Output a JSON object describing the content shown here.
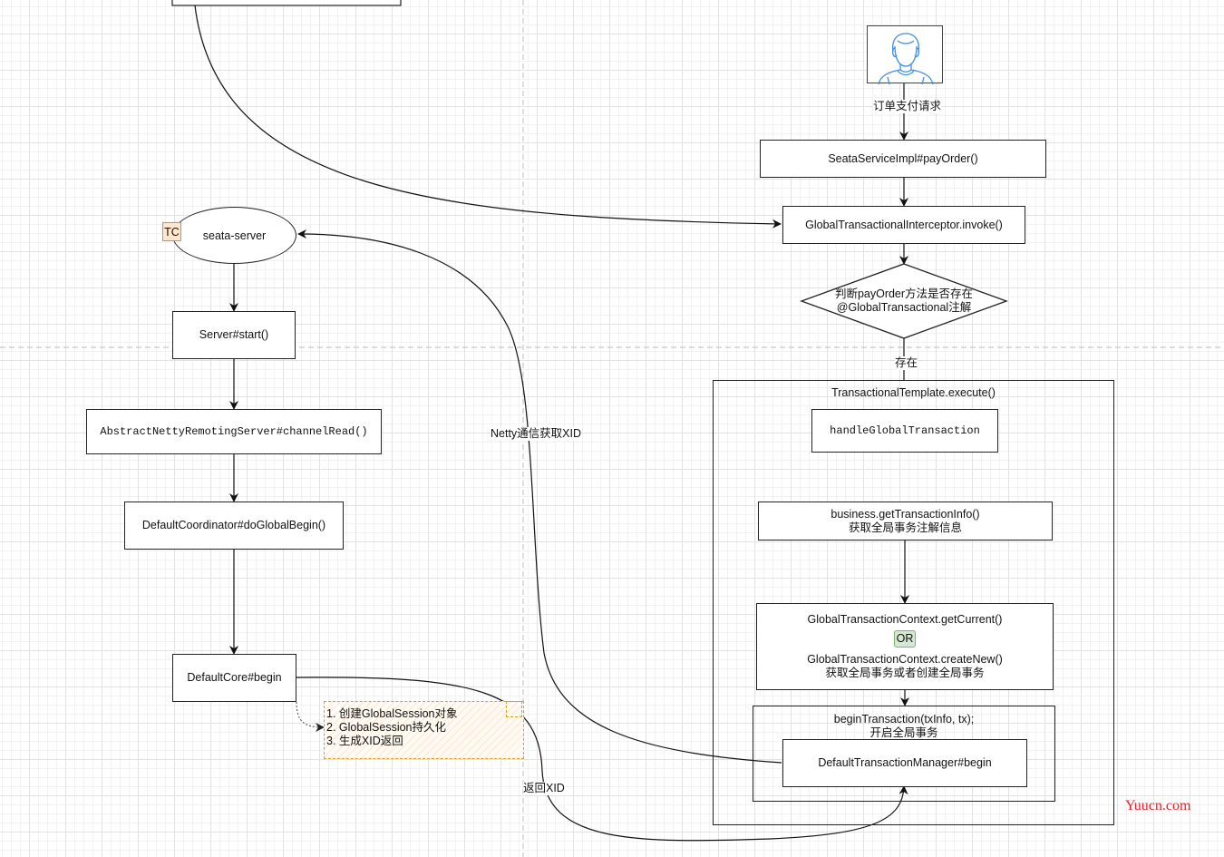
{
  "diagram": {
    "actor": {
      "icon": "user-icon",
      "request_label": "订单支付请求"
    },
    "client_flow": {
      "pay_order": "SeataServiceImpl#payOrder()",
      "interceptor": "GlobalTransactionalInterceptor.invoke()",
      "decision": [
        "判断payOrder方法是否存在",
        "@GlobalTransactional注解"
      ],
      "decision_yes_label": "存在",
      "template": {
        "title": "TransactionalTemplate.execute()",
        "handle": "handleGlobalTransaction",
        "get_info": [
          "business.getTransactionInfo()",
          "获取全局事务注解信息"
        ],
        "context": {
          "line1": "GlobalTransactionContext.getCurrent()",
          "or_badge": "OR",
          "line2": "GlobalTransactionContext.createNew()",
          "line3": "获取全局事务或者创建全局事务"
        },
        "begin_tx": {
          "line1": "beginTransaction(txInfo, tx);",
          "line2": "开启全局事务",
          "manager": "DefaultTransactionManager#begin"
        }
      }
    },
    "server_flow": {
      "server_name": "seata-server",
      "role_badge": "TC",
      "start": "Server#start()",
      "channel_read": "AbstractNettyRemotingServer#channelRead()",
      "do_global_begin": "DefaultCoordinator#doGlobalBegin()",
      "core_begin": "DefaultCore#begin",
      "note": [
        "1. 创建GlobalSession对象",
        "2. GlobalSession持久化",
        "3. 生成XID返回"
      ]
    },
    "edge_labels": {
      "netty": "Netty通信获取XID",
      "return_xid": "返回XID"
    },
    "watermark": "Yuucn.com",
    "colors": {
      "tc_badge_fill": "#ffe6cc",
      "tc_badge_stroke": "#d79b00",
      "or_fill": "#d5e8d4",
      "or_stroke": "#82b366",
      "note_stroke": "#d6a21e",
      "avatar_stroke": "#3d8fe8",
      "watermark": "#e8202a"
    }
  }
}
